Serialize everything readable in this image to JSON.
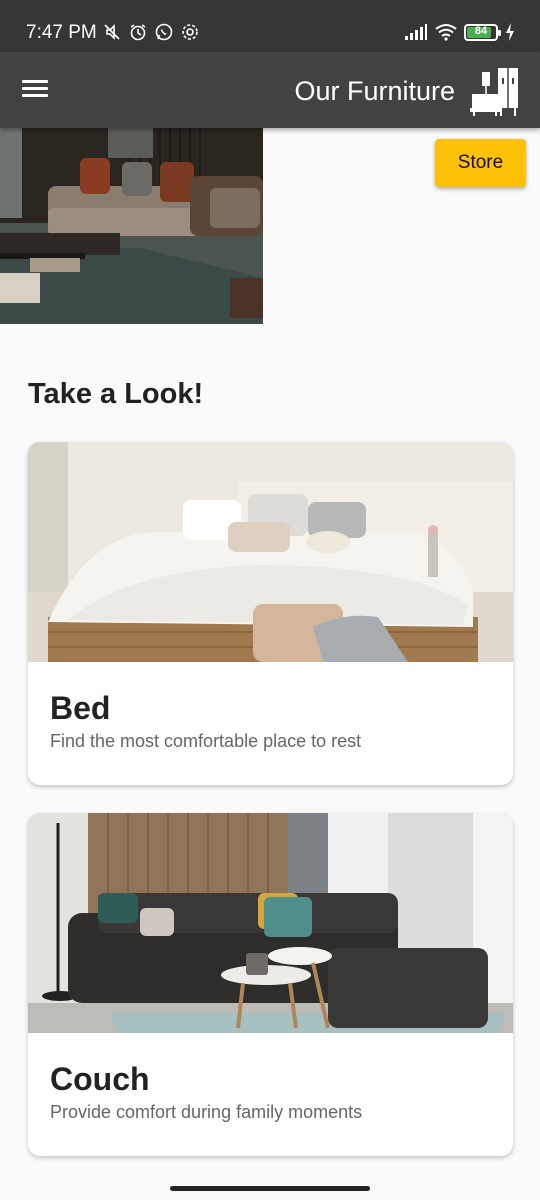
{
  "status_bar": {
    "time": "7:47 PM",
    "battery_level": "84",
    "battery_color": "#4caf50",
    "icons": [
      "mute-icon",
      "alarm-icon",
      "whatsapp-icon",
      "settings-icon",
      "signal-icon",
      "wifi-icon",
      "charging-icon"
    ]
  },
  "app_bar": {
    "title": "Our Furniture",
    "background": "#424242"
  },
  "hero": {
    "store_button_label": "Store",
    "accent": "#ffc107"
  },
  "section": {
    "title": "Take a Look!"
  },
  "cards": [
    {
      "title": "Bed",
      "subtitle": "Find the most comfortable place to rest"
    },
    {
      "title": "Couch",
      "subtitle": "Provide comfort during family moments"
    }
  ]
}
